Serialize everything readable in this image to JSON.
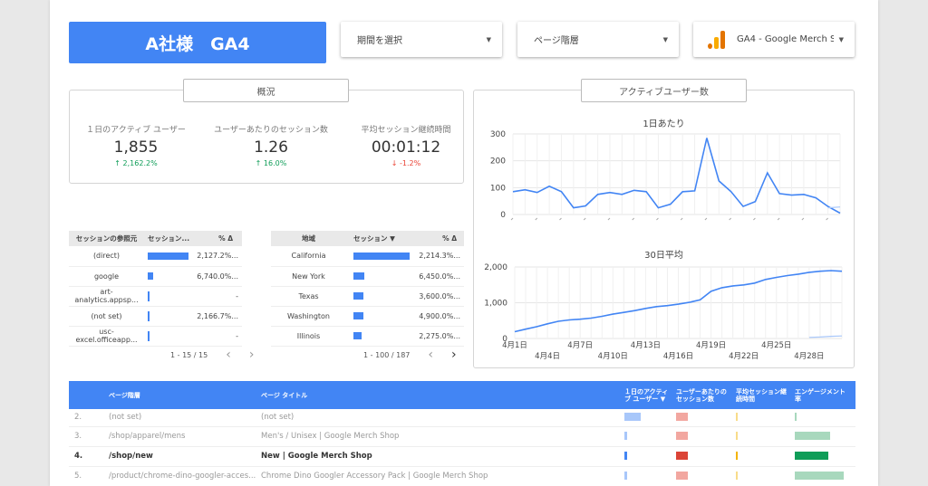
{
  "header": {
    "title": "A社様　GA4",
    "date_dropdown": "期間を選択",
    "page_dropdown": "ページ階層",
    "property_dropdown": "GA4 - Google Merch Sh"
  },
  "overview": {
    "label": "概況",
    "kpis": [
      {
        "label": "１日のアクティブ ユーザー",
        "value": "1,855",
        "delta": "2,162.2%",
        "direction": "up"
      },
      {
        "label": "ユーザーあたりのセッション数",
        "value": "1.26",
        "delta": "16.0%",
        "direction": "up"
      },
      {
        "label": "平均セッション継続時間",
        "value": "00:01:12",
        "delta": "-1.2%",
        "direction": "down"
      }
    ]
  },
  "source_table": {
    "headers": [
      "セッションの参照元",
      "セッション...",
      "% Δ"
    ],
    "rows": [
      {
        "source": "(direct)",
        "sessions_fraction": 1.0,
        "delta": "2,127.2%..."
      },
      {
        "source": "google",
        "sessions_fraction": 0.14,
        "delta": "6,740.0%..."
      },
      {
        "source": "art-analytics.appsp...",
        "sessions_fraction": 0.02,
        "delta": "-"
      },
      {
        "source": "(not set)",
        "sessions_fraction": 0.02,
        "delta": "2,166.7%..."
      },
      {
        "source": "usc-excel.officeapp...",
        "sessions_fraction": 0.01,
        "delta": "-"
      }
    ],
    "pagination": "1 - 15 / 15"
  },
  "region_table": {
    "headers": [
      "地域",
      "セッション ▼",
      "% Δ"
    ],
    "rows": [
      {
        "region": "California",
        "sessions_fraction": 1.0,
        "delta": "2,214.3%..."
      },
      {
        "region": "New York",
        "sessions_fraction": 0.2,
        "delta": "6,450.0%..."
      },
      {
        "region": "Texas",
        "sessions_fraction": 0.17,
        "delta": "3,600.0%..."
      },
      {
        "region": "Washington",
        "sessions_fraction": 0.17,
        "delta": "4,900.0%..."
      },
      {
        "region": "Illinois",
        "sessions_fraction": 0.15,
        "delta": "2,275.0%..."
      }
    ],
    "pagination": "1 - 100 / 187"
  },
  "active_users": {
    "label": "アクティブユーザー数",
    "daily_title": "1日あたり",
    "avg_title": "30日平均"
  },
  "chart_data": [
    {
      "type": "line",
      "title": "1日あたり",
      "ylim": [
        0,
        300
      ],
      "yticks": [
        0,
        100,
        200,
        300
      ],
      "series": [
        {
          "values": [
            85,
            92,
            82,
            105,
            85,
            25,
            32,
            75,
            82,
            75,
            90,
            85,
            25,
            38,
            85,
            88,
            285,
            125,
            85,
            30,
            48,
            155,
            78,
            72,
            75,
            62,
            30,
            5
          ]
        },
        {
          "values": [
            null,
            null,
            null,
            null,
            null,
            null,
            null,
            null,
            null,
            null,
            null,
            null,
            null,
            null,
            null,
            null,
            null,
            null,
            null,
            null,
            null,
            null,
            null,
            null,
            null,
            null,
            25,
            28
          ]
        }
      ]
    },
    {
      "type": "line",
      "title": "30日平均",
      "ylim": [
        0,
        2000
      ],
      "yticks": [
        "0",
        "1,000",
        "2,000"
      ],
      "xticks_top": [
        "4月1日",
        "4月7日",
        "4月13日",
        "4月19日",
        "4月25日"
      ],
      "xticks_bottom": [
        "4月4日",
        "4月10日",
        "4月16日",
        "4月22日",
        "4月28日"
      ],
      "series": [
        {
          "values": [
            190,
            260,
            330,
            410,
            480,
            520,
            540,
            570,
            620,
            680,
            730,
            780,
            840,
            890,
            920,
            960,
            1010,
            1080,
            1320,
            1420,
            1470,
            1500,
            1550,
            1650,
            1710,
            1760,
            1800,
            1850,
            1880,
            1900,
            1880
          ]
        },
        {
          "values": [
            null,
            null,
            null,
            null,
            null,
            null,
            null,
            null,
            null,
            null,
            null,
            null,
            null,
            null,
            null,
            null,
            null,
            null,
            null,
            null,
            null,
            null,
            null,
            null,
            null,
            null,
            null,
            30,
            40,
            60,
            70
          ]
        }
      ]
    }
  ],
  "page_table": {
    "headers": [
      "ページ階層",
      "ページ タイトル",
      "１日のアクティブ ユーザー ▼",
      "ユーザーあたりのセッション数",
      "平均セッション継続時間",
      "エンゲージメント率"
    ],
    "rows": [
      {
        "n": "2.",
        "path": "(not set)",
        "title": "(not set)",
        "au": 0.3,
        "spu": 0.22,
        "avg": 0.01,
        "eng": 0.01,
        "bold": false,
        "first": true
      },
      {
        "n": "3.",
        "path": "/shop/apparel/mens",
        "title": "Men's / Unisex | Google Merch Shop",
        "au": 0.05,
        "spu": 0.22,
        "avg": 0.02,
        "eng": 0.65,
        "bold": false,
        "first": false
      },
      {
        "n": "4.",
        "path": "/shop/new",
        "title": "New | Google Merch Shop",
        "au": 0.05,
        "spu": 0.22,
        "avg": 0.02,
        "eng": 0.62,
        "bold": true,
        "first": false
      },
      {
        "n": "5.",
        "path": "/product/chrome-dino-googler-acces...",
        "title": "Chrome Dino Googler Accessory Pack | Google Merch Shop",
        "au": 0.05,
        "spu": 0.22,
        "avg": 0.02,
        "eng": 0.9,
        "bold": false,
        "first": false
      }
    ]
  },
  "colors": {
    "accent": "#4285f4",
    "up": "#0f9d58",
    "down": "#ea4335",
    "ga_orange": "#f9ab00",
    "ga_dark_orange": "#e37400"
  }
}
